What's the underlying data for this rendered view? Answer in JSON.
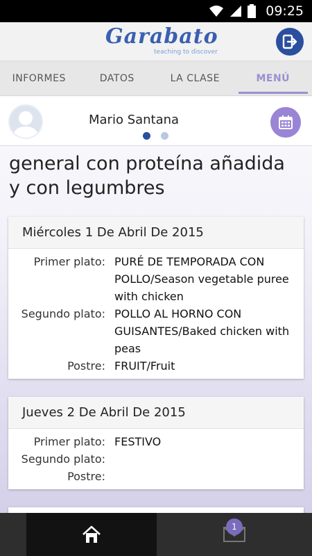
{
  "status_bar": {
    "time": "09:25"
  },
  "header": {
    "logo_text": "Garabato",
    "logo_tagline": "teaching to discover",
    "logout_icon": "logout-icon"
  },
  "tabs": [
    {
      "label": "INFORMES",
      "active": false
    },
    {
      "label": "DATOS",
      "active": false
    },
    {
      "label": "LA CLASE",
      "active": false
    },
    {
      "label": "MENÚ",
      "active": true
    }
  ],
  "profile": {
    "name": "Mario Santana",
    "page_indicator": {
      "count": 2,
      "active": 0
    },
    "calendar_icon": "calendar-icon"
  },
  "menu": {
    "title": "general con proteína añadida y con legumbres",
    "days": [
      {
        "date": "Miércoles 1 De Abril De 2015",
        "items": [
          {
            "label": "Primer plato:",
            "value": "PURÉ DE TEMPORADA CON POLLO/Season vegetable puree with chicken"
          },
          {
            "label": "Segundo plato:",
            "value": "POLLO AL HORNO CON GUISANTES/Baked chicken with peas"
          },
          {
            "label": "Postre:",
            "value": "FRUIT/Fruit"
          }
        ]
      },
      {
        "date": "Jueves 2 De Abril De 2015",
        "items": [
          {
            "label": "Primer plato:",
            "value": "FESTIVO"
          },
          {
            "label": "Segundo plato:",
            "value": ""
          },
          {
            "label": "Postre:",
            "value": ""
          }
        ]
      }
    ]
  },
  "bottom_nav": {
    "home_icon": "home-icon",
    "mail_icon": "mail-icon",
    "mail_badge": "1"
  },
  "colors": {
    "accent": "#9a84d6",
    "brand_blue": "#2b4f9e",
    "tab_active": "#9a8fd0"
  }
}
